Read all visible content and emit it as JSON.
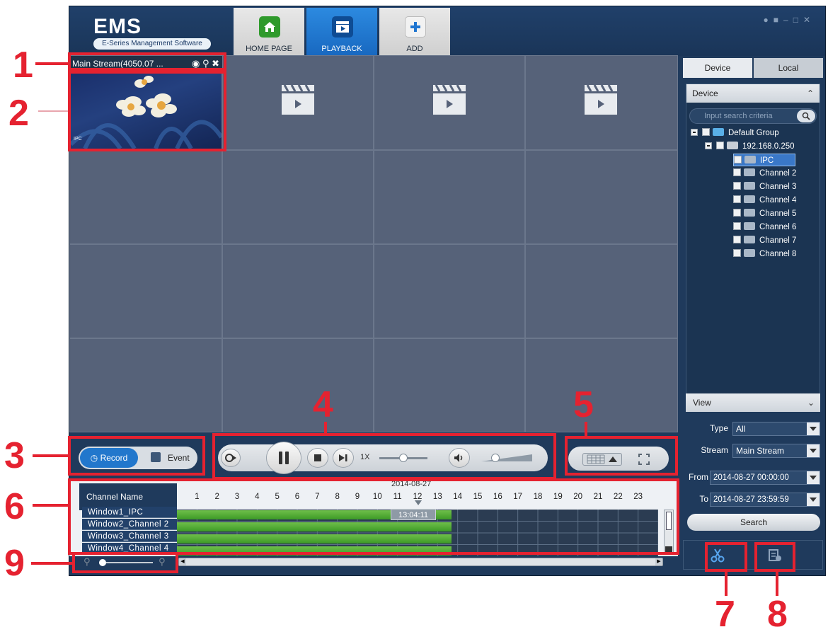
{
  "app": {
    "logo": "EMS",
    "logo_subtitle": "E-Series Management Software",
    "nav_tabs": [
      {
        "label": "HOME PAGE",
        "icon": "home-icon"
      },
      {
        "label": "PLAYBACK",
        "icon": "playback-icon",
        "active": true
      },
      {
        "label": "ADD",
        "icon": "add-icon"
      }
    ]
  },
  "stream": {
    "header": "Main Stream(4050.07 ...",
    "snapshot_icon": "camera-icon",
    "zoom_icon": "zoom-icon",
    "close_icon": "close-icon",
    "overlay_text": "IPC"
  },
  "mode_toggle": {
    "record_label": "Record",
    "event_label": "Event",
    "selected": "Record"
  },
  "player": {
    "speed": "1X",
    "speed_slider_fraction": 0.5,
    "volume_fraction": 0.2
  },
  "timeline": {
    "header": "Channel Name",
    "date": "2014-08-27",
    "cursor_time": "13:04:11",
    "hours": [
      "1",
      "2",
      "3",
      "4",
      "5",
      "6",
      "7",
      "8",
      "9",
      "10",
      "11",
      "12",
      "13",
      "14",
      "15",
      "16",
      "17",
      "18",
      "19",
      "20",
      "21",
      "22",
      "23"
    ],
    "channels": [
      "Window1_IPC",
      "Window2_Channel 2",
      "Window3_Channel 3",
      "Window4_Channel 4"
    ],
    "recorded_until_hour": 13.7
  },
  "right_panel": {
    "tabs": [
      "Device",
      "Local"
    ],
    "device_header": "Device",
    "search_placeholder": "Input search criteria",
    "tree": {
      "group": "Default Group",
      "device": "192.168.0.250",
      "channels": [
        "IPC",
        "Channel 2",
        "Channel 3",
        "Channel 4",
        "Channel 5",
        "Channel 6",
        "Channel 7",
        "Channel 8"
      ],
      "selected": "IPC"
    },
    "view_header": "View",
    "filters": {
      "type_label": "Type",
      "type_value": "All",
      "stream_label": "Stream",
      "stream_value": "Main Stream",
      "from_label": "From",
      "from_value": "2014-08-27 00:00:00",
      "to_label": "To",
      "to_value": "2014-08-27 23:59:59"
    },
    "search_button": "Search"
  },
  "bottom_tools": {
    "clip_icon": "scissors-icon",
    "download_icon": "download-icon"
  },
  "callouts": [
    "1",
    "2",
    "3",
    "4",
    "5",
    "6",
    "7",
    "8",
    "9"
  ],
  "colors": {
    "annotation_red": "#e52230",
    "app_bg": "#1f3a5c",
    "active_tab": "#1e7ad6",
    "record_bar": "#4aa82e"
  }
}
